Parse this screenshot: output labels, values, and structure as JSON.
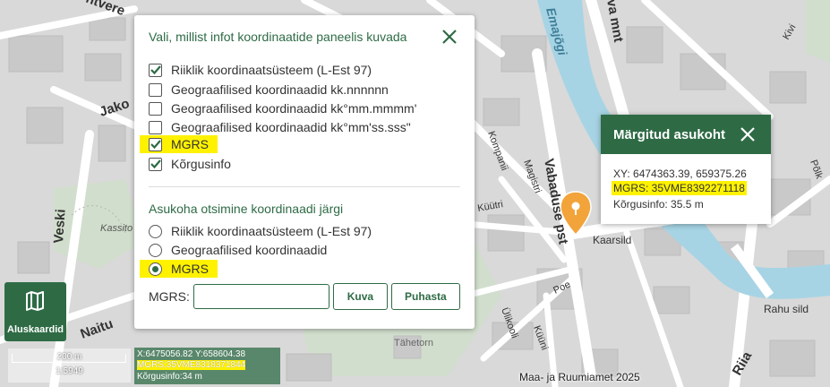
{
  "map": {
    "street_labels": [
      {
        "name": "label-emajogi",
        "text": "Emajõgi"
      },
      {
        "name": "label-vabaduse-pst",
        "text": "Vabaduse pst"
      },
      {
        "name": "label-kaarsild",
        "text": "Kaarsild"
      },
      {
        "name": "label-veski",
        "text": "Veski"
      },
      {
        "name": "label-jakobi",
        "text": "Jako"
      },
      {
        "name": "label-kompanii",
        "text": "Kompanii"
      },
      {
        "name": "label-kuutri",
        "text": "Küütri"
      },
      {
        "name": "label-magistri",
        "text": "Magistri"
      },
      {
        "name": "label-ulikooli",
        "text": "Ülikooli"
      },
      {
        "name": "label-kuuni",
        "text": "Küüni"
      },
      {
        "name": "label-poe",
        "text": "Poe"
      },
      {
        "name": "label-tahetorn",
        "text": "Tähetorn"
      },
      {
        "name": "label-rahu-sild",
        "text": "Rahu sild"
      },
      {
        "name": "label-riia",
        "text": "Riia"
      },
      {
        "name": "label-polk",
        "text": "Põlk"
      },
      {
        "name": "label-kivi",
        "text": "Kivi"
      },
      {
        "name": "label-naitu",
        "text": "Naitu"
      },
      {
        "name": "label-kassito",
        "text": "Kassito"
      },
      {
        "name": "label-va-mnt",
        "text": "va mnt"
      },
      {
        "name": "label-ntvere",
        "text": "ntvere"
      }
    ]
  },
  "coord_panel": {
    "title": "Vali, millist infot koordinaatide paneelis kuvada",
    "display_options": [
      {
        "label": "Riiklik koordinaatsüsteem (L-Est 97)",
        "checked": true,
        "highlighted": false
      },
      {
        "label": "Geograafilised koordinaadid kk.nnnnnn",
        "checked": false,
        "highlighted": false
      },
      {
        "label": "Geograafilised koordinaadid kk°mm.mmmm'",
        "checked": false,
        "highlighted": false
      },
      {
        "label": "Geograafilised koordinaadid kk°mm'ss.sss\"",
        "checked": false,
        "highlighted": false
      },
      {
        "label": "MGRS",
        "checked": true,
        "highlighted": true
      },
      {
        "label": "Kõrgusinfo",
        "checked": true,
        "highlighted": false
      }
    ],
    "search_title": "Asukoha otsimine koordinaadi järgi",
    "search_options": [
      {
        "label": "Riiklik koordinaatsüsteem (L-Est 97)",
        "selected": false,
        "highlighted": false
      },
      {
        "label": "Geograafilised koordinaadid",
        "selected": false,
        "highlighted": false
      },
      {
        "label": "MGRS",
        "selected": true,
        "highlighted": true
      }
    ],
    "mgrs_label": "MGRS:",
    "mgrs_value": "",
    "show_button": "Kuva",
    "clear_button": "Puhasta"
  },
  "marked_location": {
    "title": "Märgitud asukoht",
    "xy": "XY: 6474363.39, 659375.26",
    "mgrs": "MGRS: 35VME8392271118",
    "height": "Kõrgusinfo: 35.5 m"
  },
  "basemap_button": {
    "label": "Aluskaardid",
    "icon": "map-icon"
  },
  "scale": {
    "distance": "200 m",
    "ratio": "1:5949"
  },
  "coordinate_readout": {
    "xy": "X:6475056.82 Y:658604.38",
    "mgrs": "MGRS:35VME8318371844",
    "height": "Kõrgusinfo:34 m"
  },
  "attribution": "Maa- ja Ruumiamet 2025",
  "colors": {
    "accent": "#2e6b45",
    "highlight": "#fff200",
    "river": "#a7d4e4",
    "marker": "#f2a43a"
  }
}
